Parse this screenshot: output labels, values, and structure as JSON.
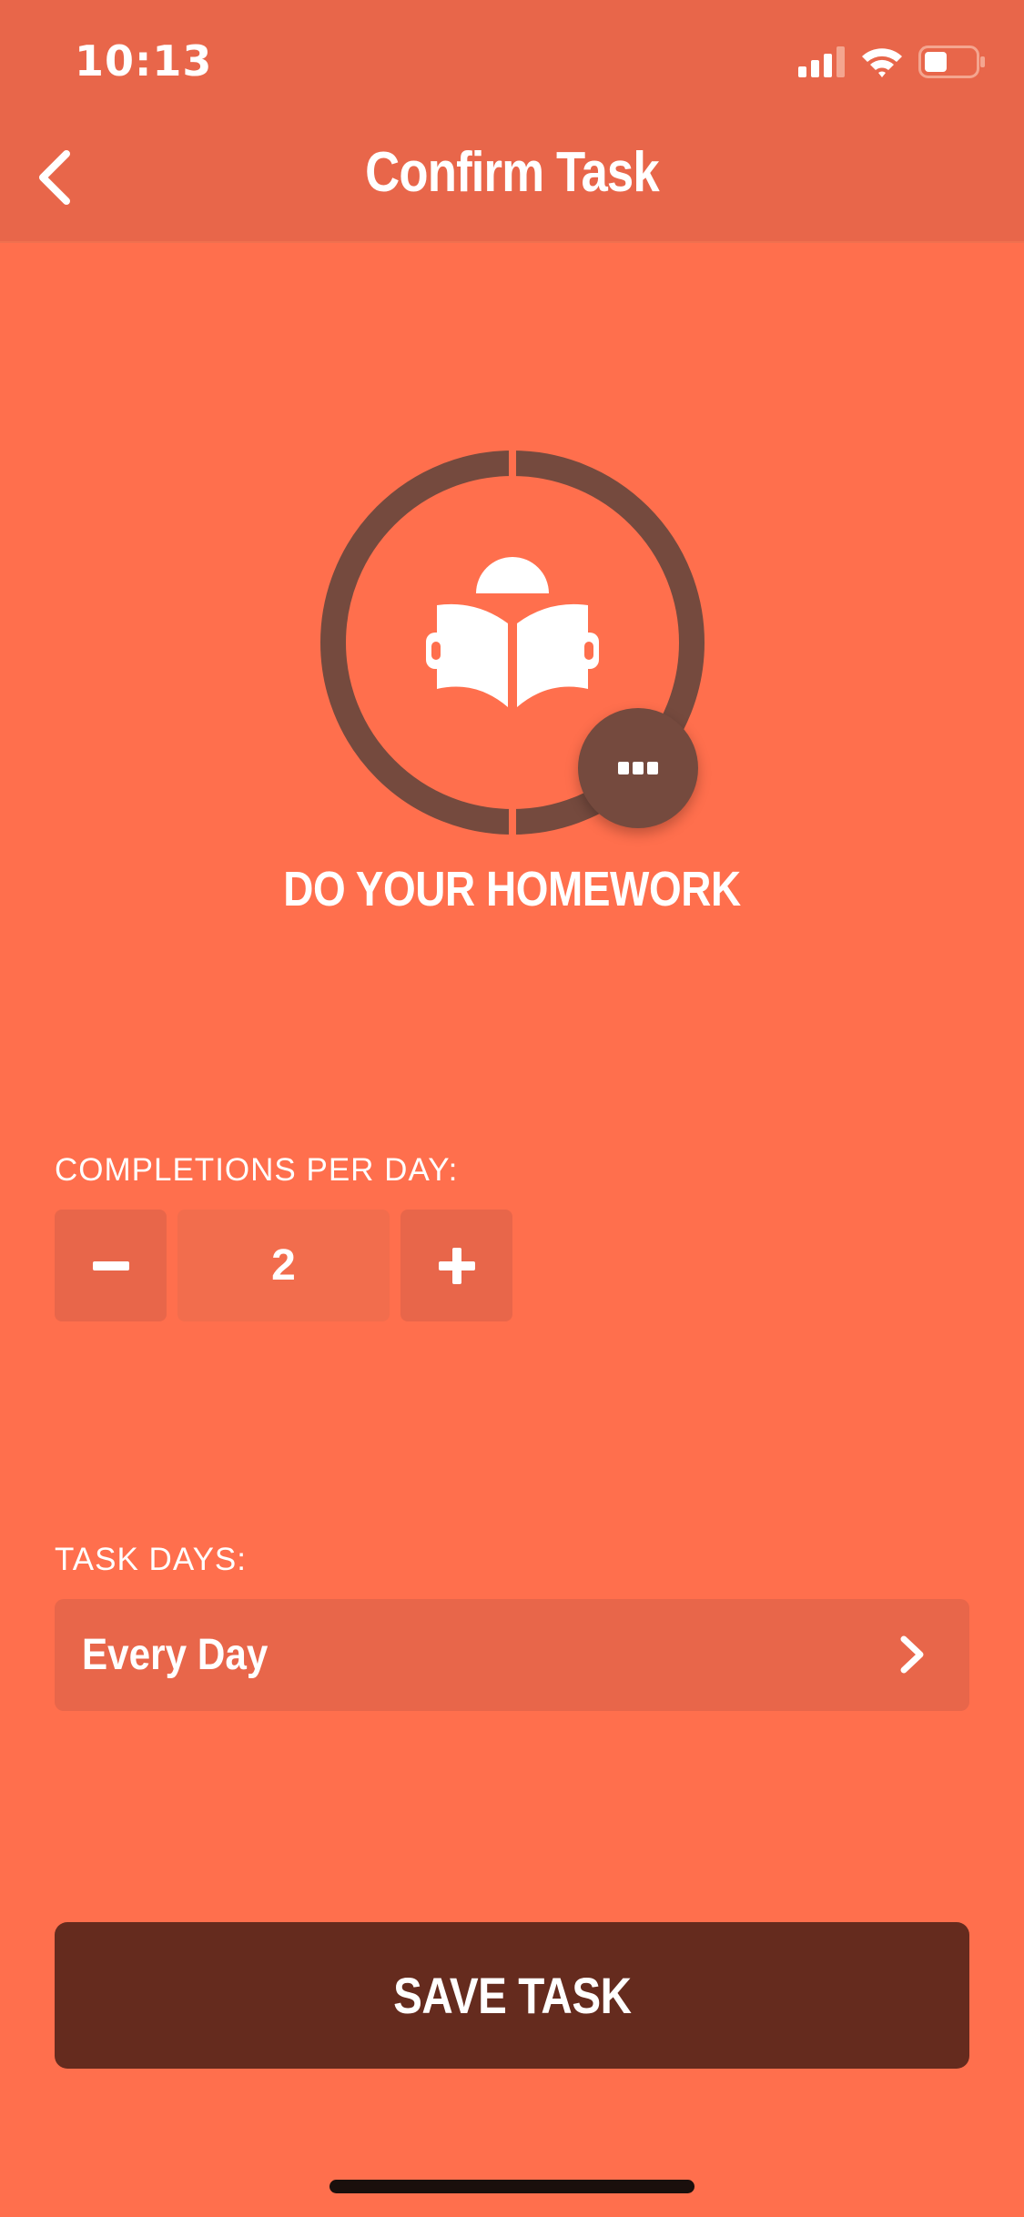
{
  "status_bar": {
    "time": "10:13",
    "icons": [
      "cellular-signal-icon",
      "wifi-icon",
      "battery-icon"
    ]
  },
  "nav": {
    "title": "Confirm Task",
    "back_icon": "chevron-left-icon"
  },
  "task": {
    "name": "DO YOUR HOMEWORK",
    "icon": "reading-book-icon",
    "more_icon": "ellipsis-icon"
  },
  "completions": {
    "label": "COMPLETIONS PER DAY:",
    "value": "2",
    "decrement_icon": "minus-icon",
    "increment_icon": "plus-icon"
  },
  "task_days": {
    "label": "TASK DAYS:",
    "value": "Every Day",
    "chevron_icon": "chevron-right-icon"
  },
  "actions": {
    "save_label": "SAVE TASK"
  },
  "colors": {
    "background": "#FF6F4D",
    "bar": "#E8664A",
    "ring": "#754A3E",
    "save_button": "#652B1E"
  }
}
